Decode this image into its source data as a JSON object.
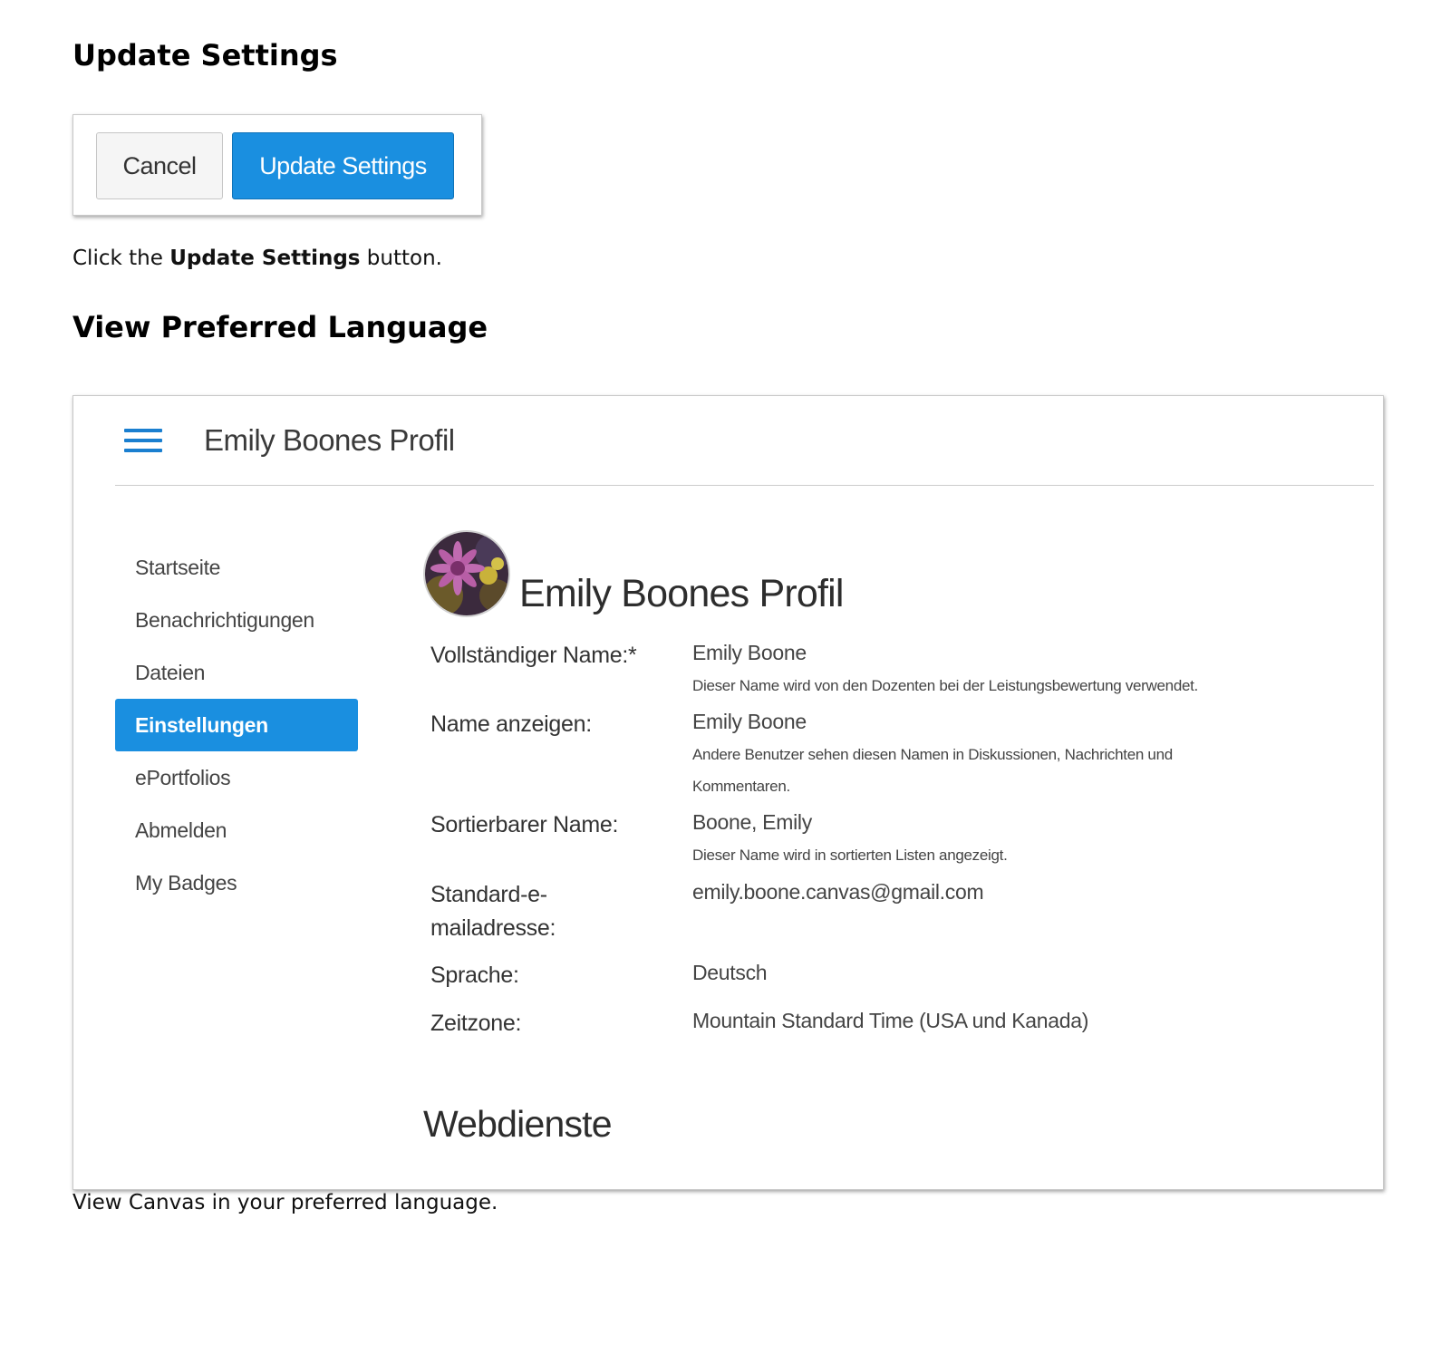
{
  "section1": {
    "heading": "Update Settings",
    "buttons": {
      "cancel_label": "Cancel",
      "update_label": "Update Settings"
    },
    "instruction_prefix": "Click the ",
    "instruction_bold": "Update Settings",
    "instruction_suffix": " button."
  },
  "section2": {
    "heading": "View Preferred Language",
    "caption": "View Canvas in your preferred language."
  },
  "profile_screen": {
    "header_title": "Emily Boones Profil",
    "nav_items": [
      {
        "label": "Startseite",
        "active": false
      },
      {
        "label": "Benachrichtigungen",
        "active": false
      },
      {
        "label": "Dateien",
        "active": false
      },
      {
        "label": "Einstellungen",
        "active": true
      },
      {
        "label": "ePortfolios",
        "active": false
      },
      {
        "label": "Abmelden",
        "active": false
      },
      {
        "label": "My Badges",
        "active": false
      }
    ],
    "profile_title": "Emily Boones Profil",
    "fields": {
      "full_name_label": "Vollständiger Name:*",
      "full_name_value": "Emily Boone",
      "full_name_hint": "Dieser Name wird von den Dozenten bei der Leistungsbewertung verwendet.",
      "display_name_label": "Name anzeigen:",
      "display_name_value": "Emily Boone",
      "display_name_hint": "Andere Benutzer sehen diesen Namen in Diskussionen, Nachrichten und Kommentaren.",
      "sortable_name_label": "Sortierbarer Name:",
      "sortable_name_value": "Boone, Emily",
      "sortable_name_hint": "Dieser Name wird in sortierten Listen angezeigt.",
      "email_label": "Standard-e-mailadresse:",
      "email_value": "emily.boone.canvas@gmail.com",
      "language_label": "Sprache:",
      "language_value": "Deutsch",
      "timezone_label": "Zeitzone:",
      "timezone_value": "Mountain Standard Time (USA und Kanada)"
    },
    "web_services_heading": "Webdienste"
  },
  "colors": {
    "accent": "#1a8fe0",
    "hamburger": "#1a7fd0"
  },
  "icons": {
    "menu": "hamburger-menu-icon",
    "avatar": "flower-avatar-image"
  }
}
